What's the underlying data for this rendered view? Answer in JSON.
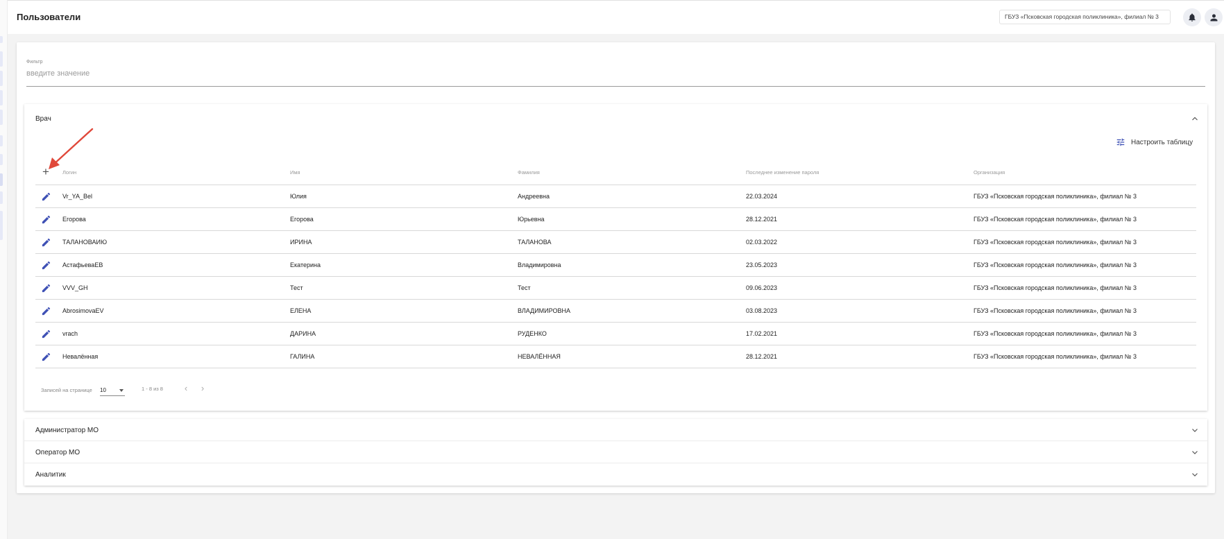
{
  "page": {
    "title": "Пользователи"
  },
  "header": {
    "organization": "ГБУЗ «Псковская городская поликлиника», филиал № 3"
  },
  "filter": {
    "label": "Фильтр",
    "placeholder": "введите значение"
  },
  "doctor_panel": {
    "title": "Врач",
    "configure_label": "Настроить таблицу",
    "columns": [
      "Логин",
      "Имя",
      "Фамилия",
      "Последнее изменение пароля",
      "Организация"
    ],
    "rows": [
      {
        "login": "Vr_YA_Bel",
        "name": "Юлия",
        "surname": "Андреевна",
        "pwd_changed": "22.03.2024",
        "org": "ГБУЗ «Псковская городская поликлиника», филиал № 3"
      },
      {
        "login": "Егорова",
        "name": "Егорова",
        "surname": "Юрьевна",
        "pwd_changed": "28.12.2021",
        "org": "ГБУЗ «Псковская городская поликлиника», филиал № 3"
      },
      {
        "login": "ТАЛАНОВАИЮ",
        "name": "ИРИНА",
        "surname": "ТАЛАНОВА",
        "pwd_changed": "02.03.2022",
        "org": "ГБУЗ «Псковская городская поликлиника», филиал № 3"
      },
      {
        "login": "АстафьеваЕВ",
        "name": "Екатерина",
        "surname": "Владимировна",
        "pwd_changed": "23.05.2023",
        "org": "ГБУЗ «Псковская городская поликлиника», филиал № 3"
      },
      {
        "login": "VVV_GH",
        "name": "Тест",
        "surname": "Тест",
        "pwd_changed": "09.06.2023",
        "org": "ГБУЗ «Псковская городская поликлиника», филиал № 3"
      },
      {
        "login": "AbrosimovaEV",
        "name": "ЕЛЕНА",
        "surname": "ВЛАДИМИРОВНА",
        "pwd_changed": "03.08.2023",
        "org": "ГБУЗ «Псковская городская поликлиника», филиал № 3"
      },
      {
        "login": "vrach",
        "name": "ДАРИНА",
        "surname": "РУДЕНКО",
        "pwd_changed": "17.02.2021",
        "org": "ГБУЗ «Псковская городская поликлиника», филиал № 3"
      },
      {
        "login": "Невалённая",
        "name": "ГАЛИНА",
        "surname": "НЕВАЛЁННАЯ",
        "pwd_changed": "28.12.2021",
        "org": "ГБУЗ «Псковская городская поликлиника», филиал № 3"
      }
    ],
    "pagination": {
      "per_page_label": "Записей на странице",
      "per_page": "10",
      "range": "1 - 8 из 8"
    }
  },
  "accordions": [
    "Администратор МО",
    "Оператор МО",
    "Аналитик"
  ],
  "colors": {
    "accent": "#3f51b5",
    "annotation": "#e0483a"
  },
  "icons": [
    "bell-icon",
    "account-icon",
    "chevron-up-icon",
    "chevron-down-icon",
    "tune-icon",
    "plus-icon",
    "pencil-icon",
    "chevron-left-icon",
    "chevron-right-icon",
    "arrow-annotation-icon"
  ]
}
